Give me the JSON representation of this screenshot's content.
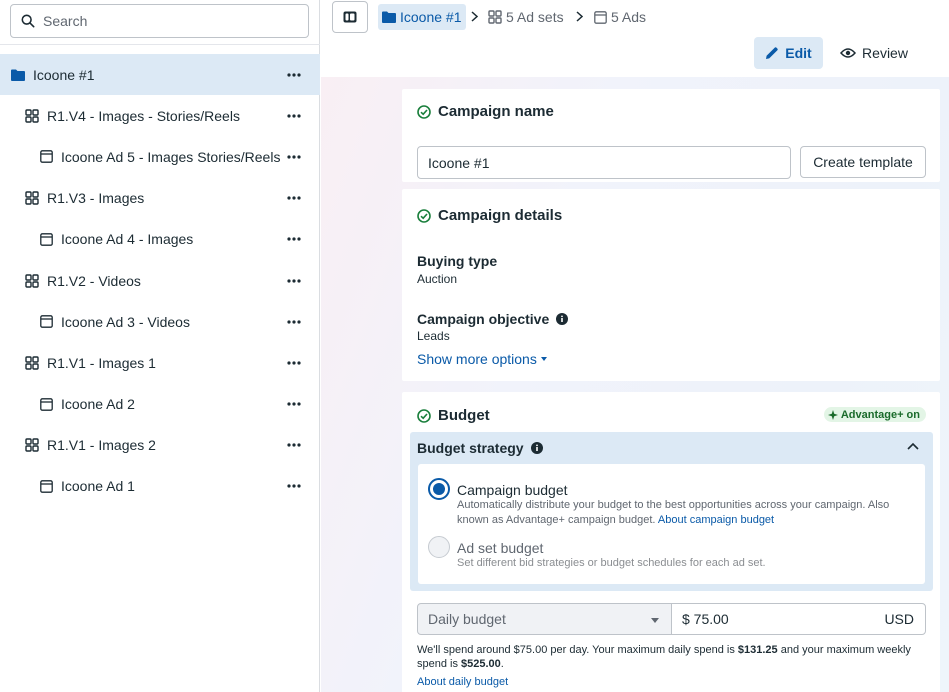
{
  "search": {
    "placeholder": "Search"
  },
  "tree": [
    {
      "label": "Icoone #1",
      "level": 0,
      "icon": "folder-icon",
      "selected": true
    },
    {
      "label": "R1.V4 - Images - Stories/Reels",
      "level": 1,
      "icon": "adset-grid-icon"
    },
    {
      "label": "Icoone Ad 5 - Images Stories/Reels",
      "level": 2,
      "icon": "ad-icon"
    },
    {
      "label": "R1.V3 - Images",
      "level": 1,
      "icon": "adset-grid-icon"
    },
    {
      "label": "Icoone Ad 4 - Images",
      "level": 2,
      "icon": "ad-icon"
    },
    {
      "label": "R1.V2 - Videos",
      "level": 1,
      "icon": "adset-grid-icon"
    },
    {
      "label": "Icoone Ad 3 - Videos",
      "level": 2,
      "icon": "ad-icon"
    },
    {
      "label": "R1.V1 - Images 1",
      "level": 1,
      "icon": "adset-grid-icon"
    },
    {
      "label": "Icoone Ad 2",
      "level": 2,
      "icon": "ad-icon"
    },
    {
      "label": "R1.V1 - Images 2",
      "level": 1,
      "icon": "adset-grid-icon"
    },
    {
      "label": "Icoone Ad 1",
      "level": 2,
      "icon": "ad-icon"
    }
  ],
  "breadcrumb": {
    "campaign": "Icoone #1",
    "adsets": "5 Ad sets",
    "ads": "5 Ads"
  },
  "toolbar": {
    "edit_label": "Edit",
    "review_label": "Review"
  },
  "campaign_name": {
    "title": "Campaign name",
    "value": "Icoone #1",
    "template_button": "Create template"
  },
  "campaign_details": {
    "title": "Campaign details",
    "buying_type_label": "Buying type",
    "buying_type_value": "Auction",
    "objective_label": "Campaign objective",
    "objective_value": "Leads",
    "show_more": "Show more options"
  },
  "budget": {
    "title": "Budget",
    "advantage_badge": "Advantage+ on",
    "strategy_label": "Budget strategy",
    "options": [
      {
        "title": "Campaign budget",
        "desc": "Automatically distribute your budget to the best opportunities across your campaign. Also known as Advantage+ campaign budget.",
        "link": "About campaign budget",
        "selected": true
      },
      {
        "title": "Ad set budget",
        "desc": "Set different bid strategies or budget schedules for each ad set.",
        "selected": false
      }
    ],
    "budget_type": "Daily budget",
    "amount": "$ 75.00",
    "currency": "USD",
    "note_prefix": "We'll spend around $75.00 per day. Your maximum daily spend is ",
    "note_max_daily": "$131.25",
    "note_middle": " and your maximum weekly spend is ",
    "note_max_weekly": "$525.00",
    "note_suffix": ".",
    "daily_link": "About daily budget"
  },
  "colors": {
    "accent": "#0a5aa8",
    "selected_bg": "#dce9f5",
    "success": "#1a7f3c"
  }
}
